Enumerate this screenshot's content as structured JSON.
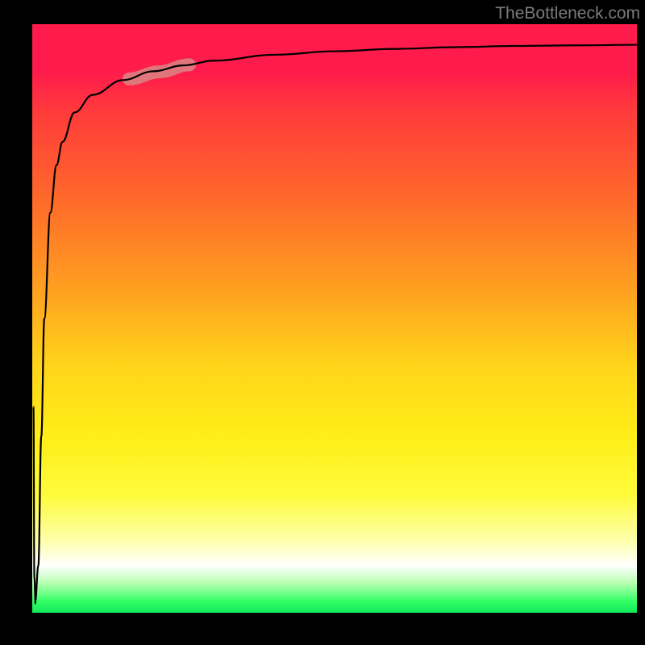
{
  "attribution": "TheBottleneck.com",
  "chart_data": {
    "type": "line",
    "title": "",
    "xlabel": "",
    "ylabel": "",
    "xlim": [
      0,
      100
    ],
    "ylim": [
      0,
      100
    ],
    "grid": false,
    "legend": false,
    "background_gradient": {
      "direction": "vertical",
      "stops": [
        {
          "pos": 0.0,
          "color": "#ff1b4c"
        },
        {
          "pos": 0.3,
          "color": "#ff6a2a"
        },
        {
          "pos": 0.58,
          "color": "#ffd41a"
        },
        {
          "pos": 0.8,
          "color": "#fffb3a"
        },
        {
          "pos": 0.92,
          "color": "#ffffff"
        },
        {
          "pos": 1.0,
          "color": "#11e85c"
        }
      ]
    },
    "series": [
      {
        "name": "curve",
        "x": [
          0.5,
          1,
          1.5,
          2,
          3,
          4,
          5,
          7,
          10,
          15,
          20,
          25,
          30,
          40,
          50,
          60,
          70,
          80,
          90,
          100
        ],
        "y": [
          2,
          8,
          30,
          50,
          68,
          76,
          80,
          85,
          88,
          90.5,
          92,
          93,
          93.8,
          94.8,
          95.4,
          95.8,
          96.1,
          96.3,
          96.4,
          96.5
        ]
      }
    ],
    "highlight_segment": {
      "series": "curve",
      "x_range": [
        16,
        26
      ],
      "y_range": [
        90.7,
        93.1
      ]
    }
  }
}
